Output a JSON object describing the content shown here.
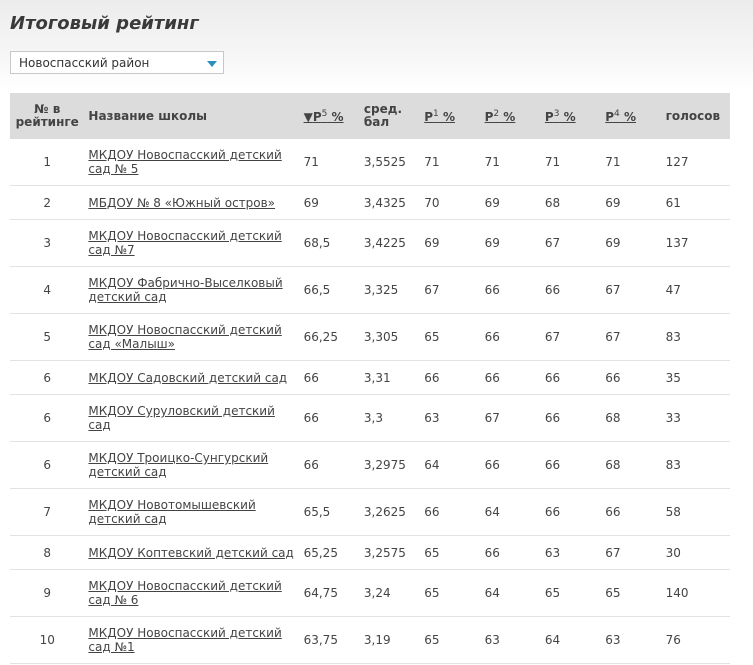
{
  "page": {
    "title": "Итоговый рейтинг"
  },
  "filter": {
    "district": "Новоспасский район"
  },
  "table": {
    "headers": {
      "rank": "№ в рейтинге",
      "name": "Название школы",
      "p5_arrow": "▼",
      "p5": "P",
      "p5_sup": "5",
      "p5_unit": " %",
      "avg": "сред. бал",
      "p1": "P",
      "p1_sup": "1",
      "p1_unit": " %",
      "p2": "P",
      "p2_sup": "2",
      "p2_unit": " %",
      "p3": "P",
      "p3_sup": "3",
      "p3_unit": " %",
      "p4": "P",
      "p4_sup": "4",
      "p4_unit": " %",
      "votes": "голосов"
    },
    "rows": [
      {
        "rank": "1",
        "name": "МКДОУ Новоспасский детский сад № 5",
        "p5": "71",
        "avg": "3,5525",
        "p1": "71",
        "p2": "71",
        "p3": "71",
        "p4": "71",
        "votes": "127"
      },
      {
        "rank": "2",
        "name": "МБДОУ № 8 «Южный остров»",
        "p5": "69",
        "avg": "3,4325",
        "p1": "70",
        "p2": "69",
        "p3": "68",
        "p4": "69",
        "votes": "61"
      },
      {
        "rank": "3",
        "name": "МКДОУ Новоспасский детский сад №7",
        "p5": "68,5",
        "avg": "3,4225",
        "p1": "69",
        "p2": "69",
        "p3": "67",
        "p4": "69",
        "votes": "137"
      },
      {
        "rank": "4",
        "name": "МКДОУ Фабрично-Выселковый детский сад",
        "p5": "66,5",
        "avg": "3,325",
        "p1": "67",
        "p2": "66",
        "p3": "66",
        "p4": "67",
        "votes": "47"
      },
      {
        "rank": "5",
        "name": "МКДОУ Новоспасский детский сад «Малыш»",
        "p5": "66,25",
        "avg": "3,305",
        "p1": "65",
        "p2": "66",
        "p3": "67",
        "p4": "67",
        "votes": "83"
      },
      {
        "rank": "6",
        "name": "МКДОУ Садовский детский сад",
        "p5": "66",
        "avg": "3,31",
        "p1": "66",
        "p2": "66",
        "p3": "66",
        "p4": "66",
        "votes": "35"
      },
      {
        "rank": "6",
        "name": "МКДОУ Суруловский детский сад",
        "p5": "66",
        "avg": "3,3",
        "p1": "63",
        "p2": "67",
        "p3": "66",
        "p4": "68",
        "votes": "33"
      },
      {
        "rank": "6",
        "name": "МКДОУ Троицко-Сунгурский детский сад",
        "p5": "66",
        "avg": "3,2975",
        "p1": "64",
        "p2": "66",
        "p3": "66",
        "p4": "68",
        "votes": "83"
      },
      {
        "rank": "7",
        "name": "МКДОУ Новотомышевский детский сад",
        "p5": "65,5",
        "avg": "3,2625",
        "p1": "66",
        "p2": "64",
        "p3": "66",
        "p4": "66",
        "votes": "58"
      },
      {
        "rank": "8",
        "name": "МКДОУ Коптевский детский сад",
        "p5": "65,25",
        "avg": "3,2575",
        "p1": "65",
        "p2": "66",
        "p3": "63",
        "p4": "67",
        "votes": "30"
      },
      {
        "rank": "9",
        "name": "МКДОУ Новоспасский детский сад № 6",
        "p5": "64,75",
        "avg": "3,24",
        "p1": "65",
        "p2": "64",
        "p3": "65",
        "p4": "65",
        "votes": "140"
      },
      {
        "rank": "10",
        "name": "МКДОУ Новоспасский детский сад №1",
        "p5": "63,75",
        "avg": "3,19",
        "p1": "65",
        "p2": "63",
        "p3": "64",
        "p4": "63",
        "votes": "76"
      }
    ]
  }
}
